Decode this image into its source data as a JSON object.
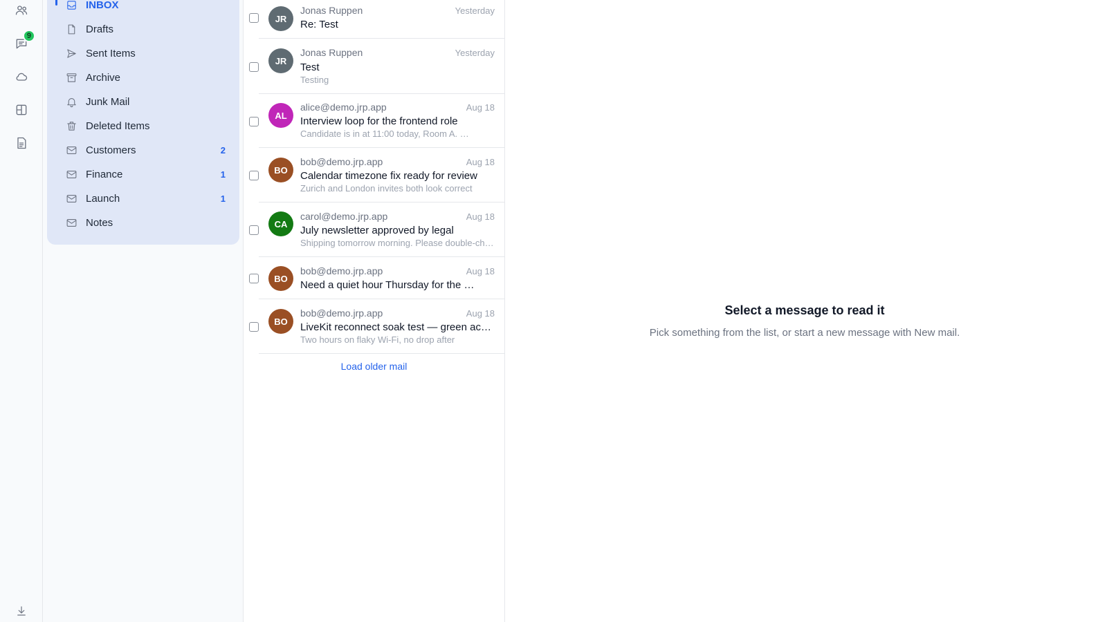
{
  "rail": {
    "chat_badge": "9"
  },
  "folders": [
    {
      "label": "INBOX",
      "count": "",
      "icon": "inbox-icon"
    },
    {
      "label": "Drafts",
      "count": "",
      "icon": "file-icon"
    },
    {
      "label": "Sent Items",
      "count": "",
      "icon": "send-icon"
    },
    {
      "label": "Archive",
      "count": "",
      "icon": "archive-icon"
    },
    {
      "label": "Junk Mail",
      "count": "",
      "icon": "bell-icon"
    },
    {
      "label": "Deleted Items",
      "count": "",
      "icon": "trash-icon"
    },
    {
      "label": "Customers",
      "count": "2",
      "icon": "mail-icon"
    },
    {
      "label": "Finance",
      "count": "1",
      "icon": "mail-icon"
    },
    {
      "label": "Launch",
      "count": "1",
      "icon": "mail-icon"
    },
    {
      "label": "Notes",
      "count": "",
      "icon": "mail-icon"
    }
  ],
  "messages": [
    {
      "initials": "JR",
      "avatar_color": "#5f6b72",
      "from": "Jonas Ruppen",
      "date": "Yesterday",
      "subject": "Re: Test",
      "preview": ""
    },
    {
      "initials": "JR",
      "avatar_color": "#5f6b72",
      "from": "Jonas Ruppen",
      "date": "Yesterday",
      "subject": "Test",
      "preview": "Testing"
    },
    {
      "initials": "AL",
      "avatar_color": "#c026b8",
      "from": "alice@demo.jrp.app",
      "date": "Aug 18",
      "subject": "Interview loop for the frontend role",
      "preview": "Candidate is in at 11:00 today, Room A. …"
    },
    {
      "initials": "BO",
      "avatar_color": "#9a4f24",
      "from": "bob@demo.jrp.app",
      "date": "Aug 18",
      "subject": "Calendar timezone fix ready for review",
      "preview": "Zurich and London invites both look correct"
    },
    {
      "initials": "CA",
      "avatar_color": "#137a13",
      "from": "carol@demo.jrp.app",
      "date": "Aug 18",
      "subject": "July newsletter approved by legal",
      "preview": "Shipping tomorrow morning. Please double-check"
    },
    {
      "initials": "BO",
      "avatar_color": "#9a4f24",
      "from": "bob@demo.jrp.app",
      "date": "Aug 18",
      "subject": "Need a quiet hour Thursday for the …",
      "preview": ""
    },
    {
      "initials": "BO",
      "avatar_color": "#9a4f24",
      "from": "bob@demo.jrp.app",
      "date": "Aug 18",
      "subject": "LiveKit reconnect soak test — green across the board",
      "preview": "Two hours on flaky Wi-Fi, no drop after"
    }
  ],
  "load_older": "Load older mail",
  "reader": {
    "title": "Select a message to read it",
    "subtitle": "Pick something from the list, or start a new message with New mail."
  },
  "colors": {
    "accent": "#2563eb",
    "folder_bg": "#e0e7f7",
    "badge": "#22c55e"
  }
}
